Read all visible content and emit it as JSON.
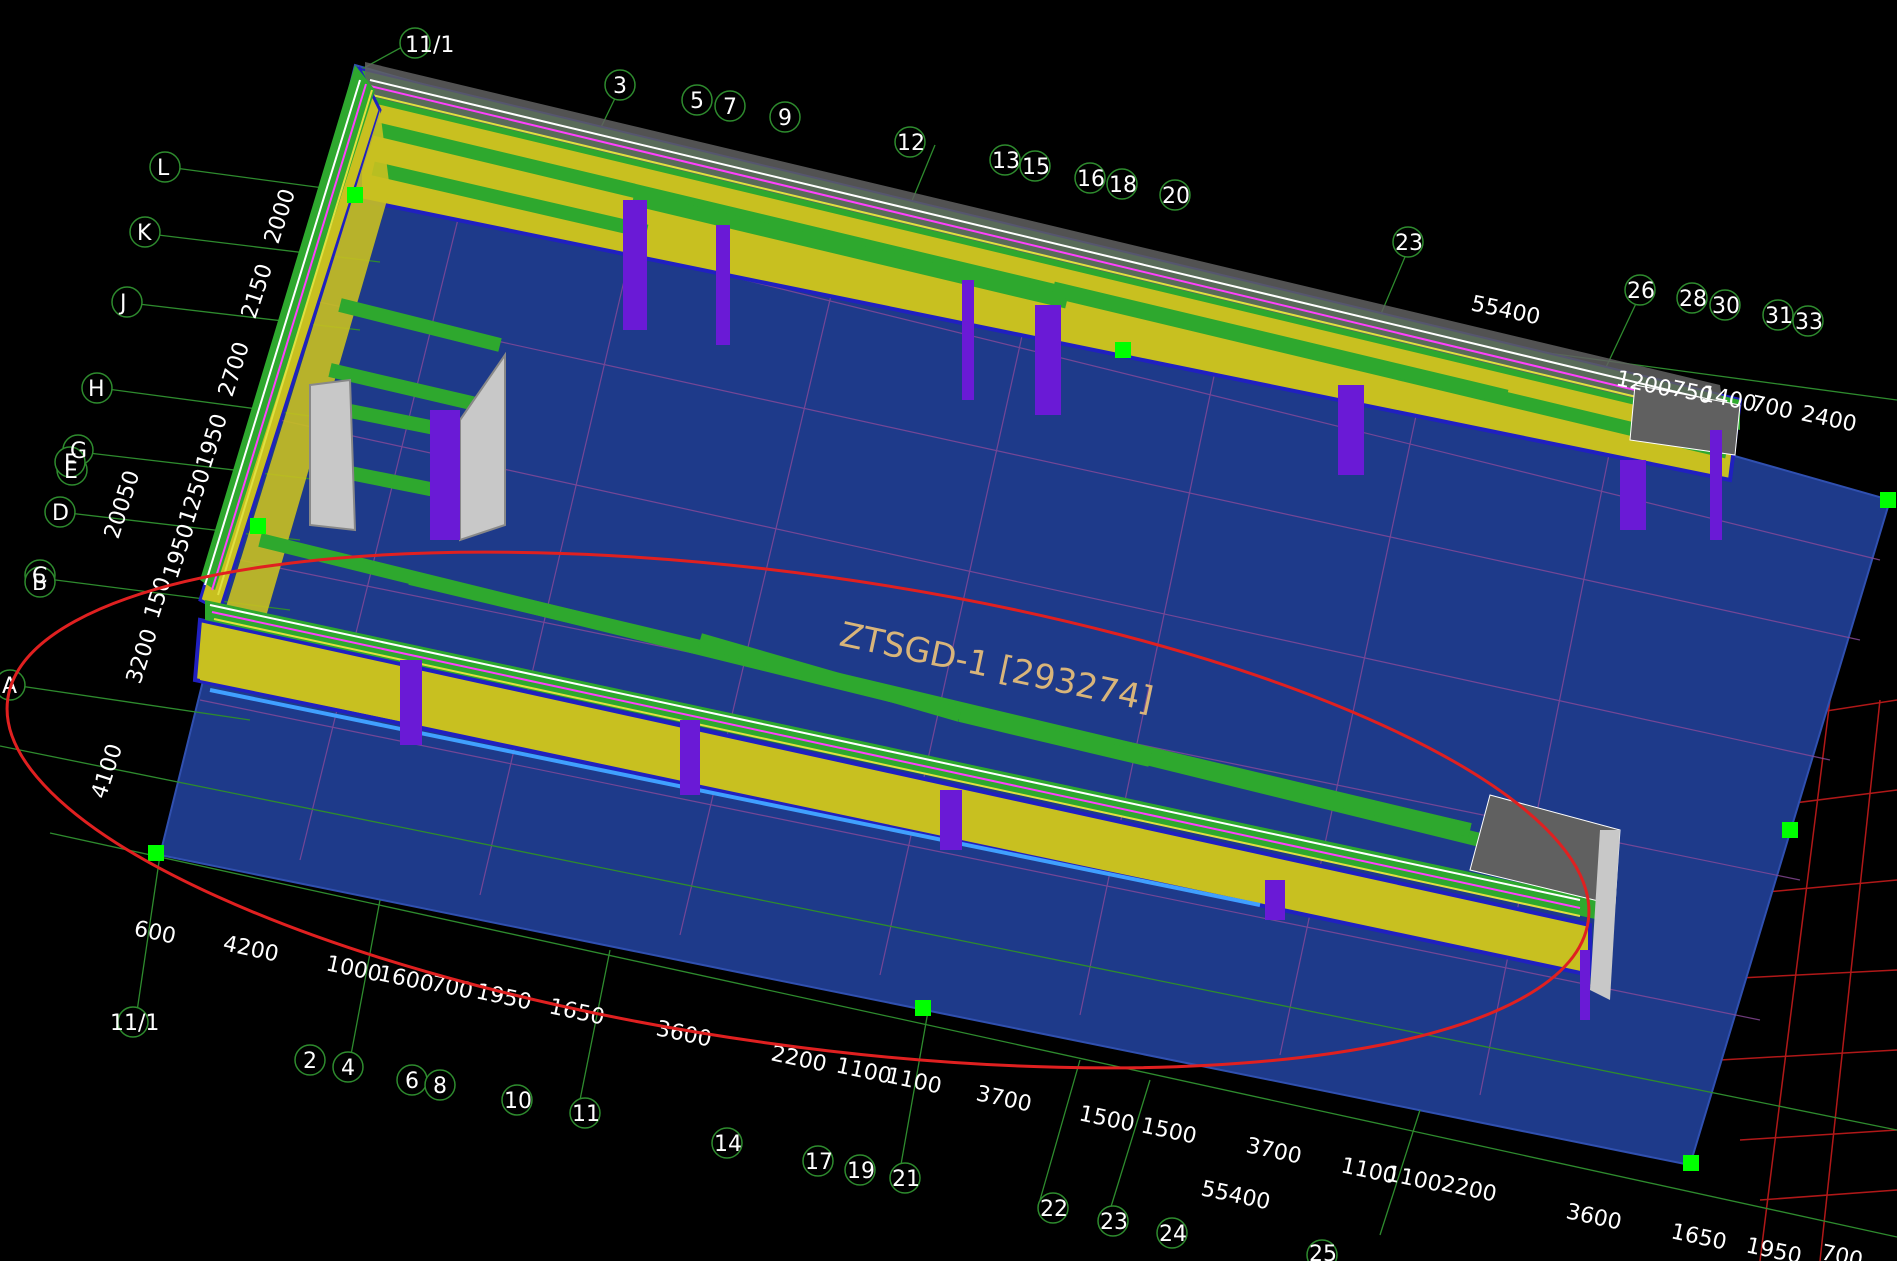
{
  "drawing": {
    "element_label": "ZTSGD-1 [293274]"
  },
  "axes_top": [
    "11/1",
    "3",
    "5",
    "7",
    "9",
    "12",
    "13",
    "15",
    "16",
    "18",
    "20",
    "23",
    "26",
    "28",
    "30",
    "31",
    "33"
  ],
  "axes_left": [
    "L",
    "K",
    "J",
    "H",
    "G",
    "F",
    "E",
    "D",
    "C",
    "B",
    "A"
  ],
  "axes_bottom": [
    "11/1",
    "2",
    "4",
    "6",
    "8",
    "10",
    "11",
    "14",
    "17",
    "19",
    "21",
    "22",
    "23",
    "24",
    "25"
  ],
  "dims_left": [
    "2000",
    "2150",
    "2700",
    "1950",
    "1250",
    "20050",
    "1950",
    "150",
    "3200",
    "4100"
  ],
  "dims_top": [
    "55400",
    "1200",
    "750",
    "1400",
    "700",
    "2400"
  ],
  "dims_bottom": [
    "600",
    "4200",
    "1000",
    "1600",
    "700",
    "1950",
    "1650",
    "3600",
    "2200",
    "1100",
    "1100",
    "3700",
    "1500",
    "1500",
    "3700",
    "1100",
    "1100",
    "2200",
    "3600",
    "55400",
    "1650",
    "1950",
    "700"
  ],
  "colors": {
    "background": "#000000",
    "floor_slab": "#1e3a8a",
    "axis_lines": "#2e8b2e",
    "wall_yellow": "#c8c020",
    "beam_green": "#2ea82e",
    "column_purple": "#6a1ad6",
    "highlight_ellipse": "#e02020"
  }
}
